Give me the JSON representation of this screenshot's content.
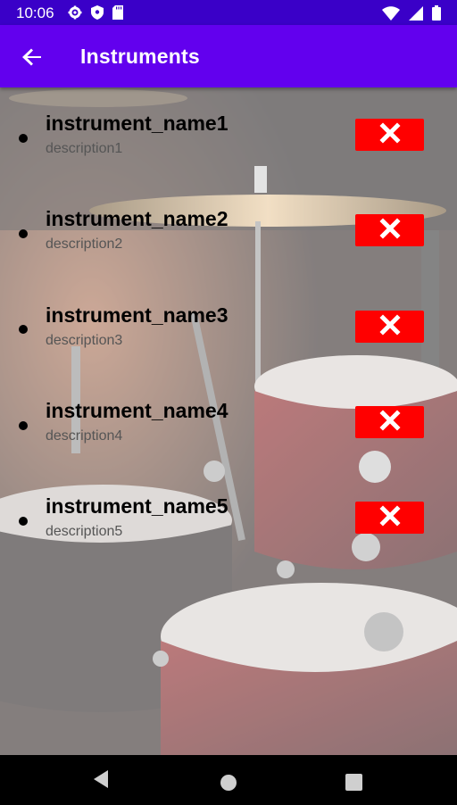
{
  "status_bar": {
    "time": "10:06",
    "left_icons": [
      "gear-icon",
      "shield-icon",
      "sd-card-icon"
    ],
    "right_icons": [
      "wifi-icon",
      "signal-icon",
      "battery-icon"
    ]
  },
  "app_bar": {
    "title": "Instruments",
    "background": "#6200ee"
  },
  "instruments": [
    {
      "name": "instrument_name1",
      "description": "description1"
    },
    {
      "name": "instrument_name2",
      "description": "description2"
    },
    {
      "name": "instrument_name3",
      "description": "description3"
    },
    {
      "name": "instrument_name4",
      "description": "description4"
    },
    {
      "name": "instrument_name5",
      "description": "description5"
    }
  ],
  "delete_button": {
    "color": "#ff0000",
    "icon": "close-icon"
  },
  "nav_bar": {
    "buttons": [
      "back-icon",
      "home-icon",
      "recents-icon"
    ]
  }
}
